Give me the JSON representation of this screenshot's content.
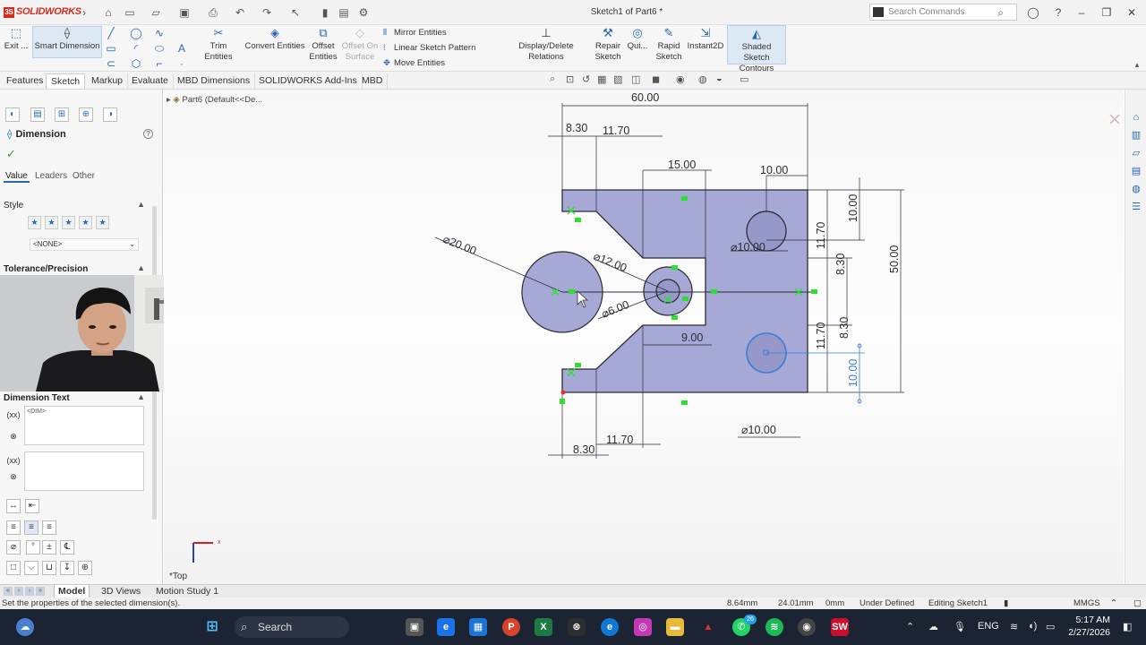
{
  "app": {
    "logo_text": "SOLIDWORKS",
    "window_title": "Sketch1 of Part6 *",
    "search_placeholder": "Search Commands"
  },
  "ribbon": {
    "exit_label": "Exit ...",
    "smart_dimension": "Smart Dimension",
    "trim_entities": "Trim Entities",
    "convert_entities": "Convert Entities",
    "offset_entities_1": "Offset",
    "offset_entities_2": "Entities",
    "offset_surface_1": "Offset On",
    "offset_surface_2": "Surface",
    "mirror_entities": "Mirror Entities",
    "linear_pattern": "Linear Sketch Pattern",
    "move_entities": "Move Entities",
    "display_relations": "Display/Delete Relations",
    "repair_sketch_1": "Repair",
    "repair_sketch_2": "Sketch",
    "quick_snaps": "Qui...",
    "rapid_sketch_1": "Rapid",
    "rapid_sketch_2": "Sketch",
    "instant2d": "Instant2D",
    "shaded_contours_1": "Shaded Sketch",
    "shaded_contours_2": "Contours"
  },
  "tabs": [
    "Features",
    "Sketch",
    "Markup",
    "Evaluate",
    "MBD Dimensions",
    "SOLIDWORKS Add-Ins",
    "MBD"
  ],
  "active_tab": "Sketch",
  "property_manager": {
    "title": "Dimension",
    "subtabs": [
      "Value",
      "Leaders",
      "Other"
    ],
    "style_header": "Style",
    "style_select": "<NONE>",
    "tolerance_header": "Tolerance/Precision",
    "dimension_text_header": "Dimension Text",
    "dim_placeholder": "<DIM>"
  },
  "tree": {
    "part_label": "Part6  (Default<<De..."
  },
  "view_label": "*Top",
  "dimensions": {
    "overall_width": "60.00",
    "top_8_30": "8.30",
    "top_11_70": "11.70",
    "top_15": "15.00",
    "top_10": "10.00",
    "dia_20": "⌀20.00",
    "dia_12": "⌀12.00",
    "dia_6": "⌀6.00",
    "dia_10_upper": "⌀10.00",
    "dia_10_lower": "⌀10.00",
    "slot_9": "9.00",
    "bottom_11_70": "11.70",
    "bottom_8_30": "8.30",
    "right_10": "10.00",
    "right_11_70_a": "11.70",
    "right_8_30_a": "8.30",
    "right_8_30_b": "8.30",
    "right_11_70_b": "11.70",
    "right_10_selected": "10.00",
    "overall_height": "50.00"
  },
  "bottom_tabs": [
    "Model",
    "3D Views",
    "Motion Study 1"
  ],
  "active_bottom_tab": "Model",
  "status": {
    "message": "Set the properties of the selected dimension(s).",
    "x": "8.64mm",
    "y": "24.01mm",
    "z": "0mm",
    "state": "Under Defined",
    "editing": "Editing Sketch1",
    "units": "MMGS"
  },
  "taskbar": {
    "search": "Search",
    "language": "ENG",
    "time": "5:17 AM",
    "date": "2/27/2026",
    "whatsapp_badge": "26"
  },
  "colors": {
    "sketch_fill": "#a6a8d6",
    "sketch_line": "#2b2b35",
    "relation_green": "#2ee02e",
    "selected_blue": "#3b7ed6",
    "accent_blue": "#2a66b3"
  }
}
